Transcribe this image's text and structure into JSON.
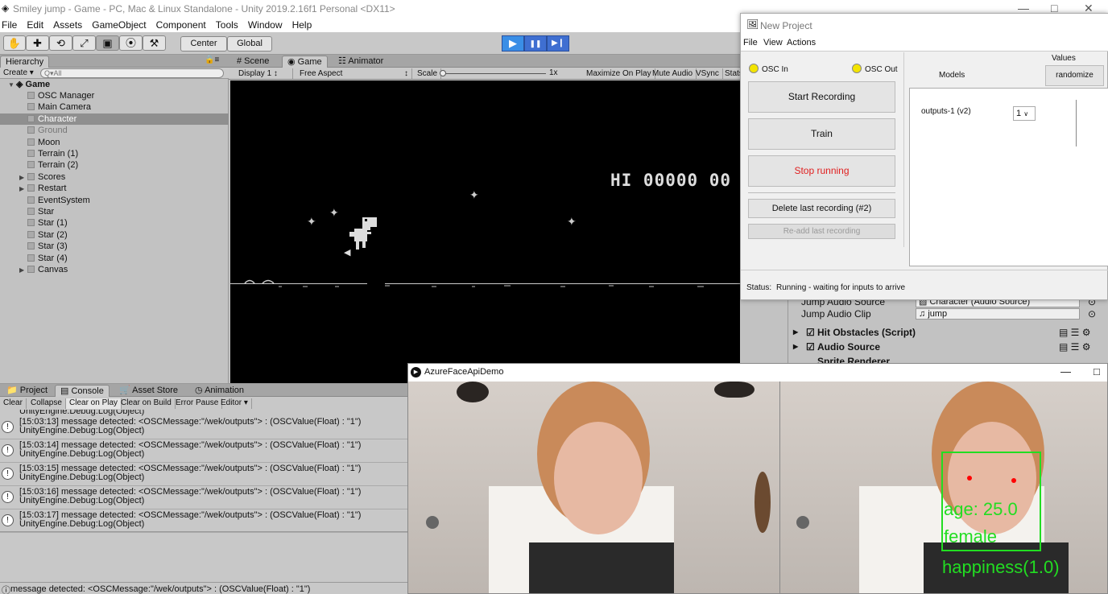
{
  "window": {
    "title": "Smiley jump - Game - PC, Mac & Linux Standalone - Unity 2019.2.16f1 Personal <DX11>",
    "controls": [
      "—",
      "□",
      "✕"
    ]
  },
  "menu": [
    "File",
    "Edit",
    "Assets",
    "GameObject",
    "Component",
    "Tools",
    "Window",
    "Help"
  ],
  "toolbar": {
    "tools": [
      "✋",
      "✚",
      "⟲",
      "⤢",
      "▣",
      "⦿",
      "⚒"
    ],
    "center_label": "Center",
    "global_label": "Global",
    "play": "▶",
    "pause": "❚❚",
    "step": "▶❙"
  },
  "hierarchy": {
    "tab": "Hierarchy",
    "create": "Create ▾",
    "search_placeholder": "Q▾All",
    "scene": "Game",
    "items": [
      {
        "label": "OSC Manager",
        "dim": false,
        "expandable": false
      },
      {
        "label": "Main Camera",
        "dim": false,
        "expandable": false
      },
      {
        "label": "Character",
        "dim": false,
        "expandable": false,
        "selected": true
      },
      {
        "label": "Ground",
        "dim": true,
        "expandable": false
      },
      {
        "label": "Moon",
        "dim": false,
        "expandable": false
      },
      {
        "label": "Terrain (1)",
        "dim": false,
        "expandable": false
      },
      {
        "label": "Terrain (2)",
        "dim": false,
        "expandable": false
      },
      {
        "label": "Scores",
        "dim": false,
        "expandable": true
      },
      {
        "label": "Restart",
        "dim": false,
        "expandable": true
      },
      {
        "label": "EventSystem",
        "dim": false,
        "expandable": false
      },
      {
        "label": "Star",
        "dim": false,
        "expandable": false
      },
      {
        "label": "Star (1)",
        "dim": false,
        "expandable": false
      },
      {
        "label": "Star (2)",
        "dim": false,
        "expandable": false
      },
      {
        "label": "Star (3)",
        "dim": false,
        "expandable": false
      },
      {
        "label": "Star (4)",
        "dim": false,
        "expandable": false
      },
      {
        "label": "Canvas",
        "dim": false,
        "expandable": true
      }
    ]
  },
  "views": {
    "tabs": [
      "# Scene",
      "Game",
      "Animator"
    ],
    "gamebar": {
      "display": "Display 1",
      "aspect": "Free Aspect",
      "scale_label": "Scale",
      "scale_value": "1x",
      "maximize": "Maximize On Play",
      "mute": "Mute Audio",
      "vsync": "VSync",
      "stats": "Stats"
    },
    "game_text": "HI 00000 00"
  },
  "console": {
    "tabs": [
      "Project",
      "Console",
      "Asset Store",
      "Animation"
    ],
    "buttons": [
      "Clear",
      "Collapse",
      "Clear on Play",
      "Clear on Build",
      "Error Pause",
      "Editor ▾"
    ],
    "partial_top": "UnityEngine.Debug:Log(Object)",
    "entries": [
      {
        "line1": "[15:03:13] message detected: <OSCMessage:\"/wek/outputs\"> : (OSCValue(Float) : \"1\")",
        "line2": "UnityEngine.Debug:Log(Object)"
      },
      {
        "line1": "[15:03:14] message detected: <OSCMessage:\"/wek/outputs\"> : (OSCValue(Float) : \"1\")",
        "line2": "UnityEngine.Debug:Log(Object)"
      },
      {
        "line1": "[15:03:15] message detected: <OSCMessage:\"/wek/outputs\"> : (OSCValue(Float) : \"1\")",
        "line2": "UnityEngine.Debug:Log(Object)"
      },
      {
        "line1": "[15:03:16] message detected: <OSCMessage:\"/wek/outputs\"> : (OSCValue(Float) : \"1\")",
        "line2": "UnityEngine.Debug:Log(Object)"
      },
      {
        "line1": "[15:03:17] message detected: <OSCMessage:\"/wek/outputs\"> : (OSCValue(Float) : \"1\")",
        "line2": "UnityEngine.Debug:Log(Object)"
      }
    ],
    "statusbar": "message detected: <OSCMessage:\"/wek/outputs\"> : (OSCValue(Float) : \"1\")"
  },
  "inspector": {
    "jump_audio_source_label": "Jump Audio Source",
    "jump_audio_source_value": "Character (Audio Source)",
    "jump_audio_clip_label": "Jump Audio Clip",
    "jump_audio_clip_value": "jump",
    "hit_obstacles": "Hit Obstacles (Script)",
    "audio_source": "Audio Source",
    "sprite_renderer": "Sprite Renderer"
  },
  "wekinator": {
    "title": "New Project",
    "menu": [
      "File",
      "View",
      "Actions"
    ],
    "osc_in": "OSC In",
    "osc_out": "OSC Out",
    "start_recording": "Start Recording",
    "train": "Train",
    "stop_running": "Stop running",
    "delete_last": "Delete last recording (#2)",
    "readd_last": "Re-add last recording",
    "values_label": "Values",
    "models_label": "Models",
    "randomize": "randomize",
    "model_name": "outputs-1 (v2)",
    "model_value": "1",
    "status_label": "Status:",
    "status_text": "Running - waiting for inputs to arrive",
    "accent_red": "#e02020",
    "led_color": "#f3e400"
  },
  "facedemo": {
    "title": "AzureFaceApiDemo",
    "controls": [
      "—",
      "□"
    ],
    "age": "age: 25.0",
    "gender": "female",
    "emotion": "happiness(1.0)",
    "overlay_color": "#22dd22"
  }
}
